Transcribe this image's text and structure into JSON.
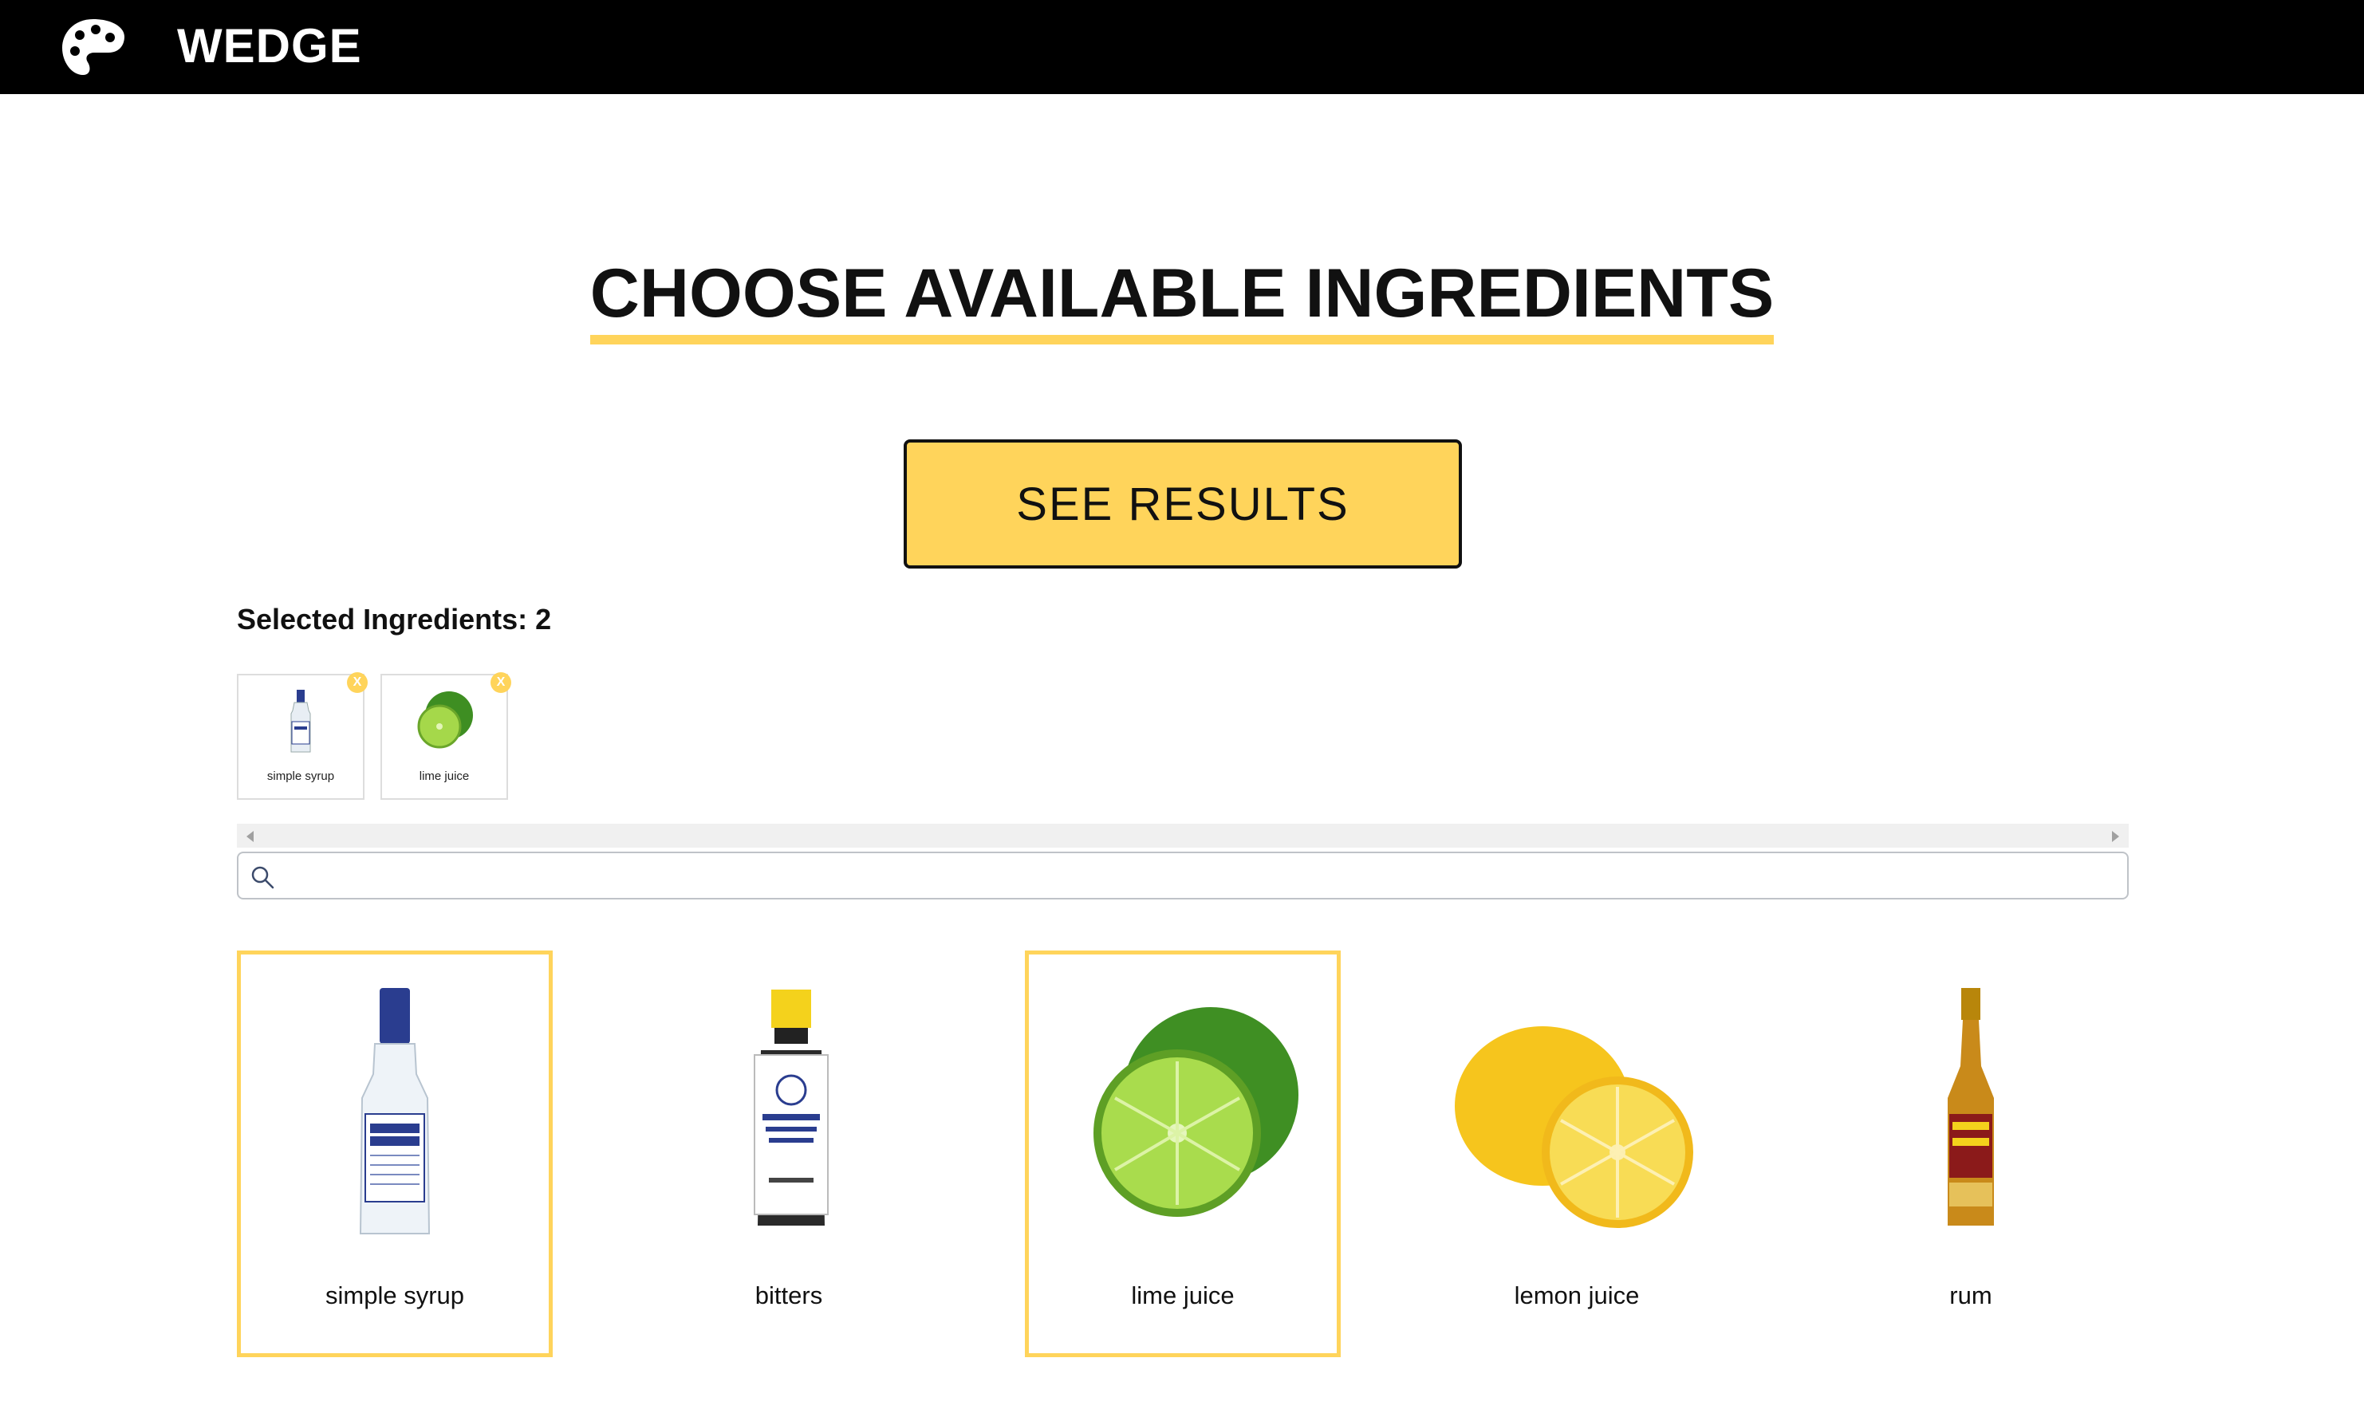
{
  "header": {
    "brand": "WEDGE",
    "logo_icon": "palette-icon"
  },
  "main": {
    "title": "CHOOSE AVAILABLE INGREDIENTS",
    "see_results_label": "SEE RESULTS",
    "selected_label": "Selected Ingredients: 2",
    "search": {
      "value": "",
      "placeholder": "",
      "icon": "search-icon"
    }
  },
  "selected_chips": [
    {
      "label": "simple syrup",
      "remove": "X",
      "icon": "syrup-bottle-icon"
    },
    {
      "label": "lime juice",
      "remove": "X",
      "icon": "lime-icon"
    }
  ],
  "ingredients": [
    {
      "label": "simple syrup",
      "selected": true,
      "icon": "syrup-bottle-icon"
    },
    {
      "label": "bitters",
      "selected": false,
      "icon": "bitters-bottle-icon"
    },
    {
      "label": "lime juice",
      "selected": true,
      "icon": "lime-icon"
    },
    {
      "label": "lemon juice",
      "selected": false,
      "icon": "lemon-icon"
    },
    {
      "label": "rum",
      "selected": false,
      "icon": "rum-bottle-icon"
    }
  ],
  "colors": {
    "accent": "#ffd45b",
    "header_bg": "#000000",
    "text": "#111111"
  }
}
